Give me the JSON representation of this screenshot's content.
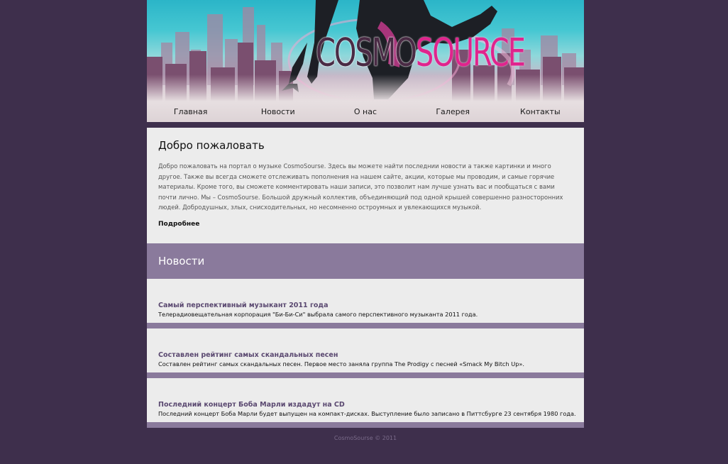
{
  "brand": {
    "logo_part1": "COSMO",
    "logo_part2": "SOURCE"
  },
  "nav": {
    "items": [
      "Главная",
      "Новости",
      "О нас",
      "Галерея",
      "Контакты"
    ]
  },
  "welcome": {
    "title": "Добро пожаловать",
    "text": "Добро пожаловать на портал о музыке CosmoSourse. Здесь вы можете найти последнии новости а также картинки и много другое. Также вы всегда сможете отслеживать пополнения на нашем сайте, акции, которые мы проводим, и самые горячие материалы. Кроме того, вы сможете комментировать наши записи, это позволит нам лучше узнать вас и пообщаться с вами почти лично. Мы – CosmoSourse. Большой дружный коллектив, объединяющий под одной крышей совершенно разносторонних людей. Добродушных, злых, снисходительных, но несомненно остроумных и увлекающихся музыкой.",
    "more_label": "Подробнее"
  },
  "news": {
    "heading": "Новости",
    "items": [
      {
        "title": "Самый перспективный музыкант 2011 года",
        "text": "Телерадиовещательная корпорация \"Би-Би-Си\" выбрала самого перспективного музыканта 2011 года."
      },
      {
        "title": "Составлен рейтинг самых скандальных песен",
        "text": "Составлен рейтинг самых скандальных песен. Первое место заняла группа The Prodigy с песней «Smack My Bitch Up»."
      },
      {
        "title": "Последний концерт Боба Марли издадут на CD",
        "text": "Последний концерт Боба Марли будет выпущен на компакт-дисках. Выступление было записано в Питтсбурге 23 сентября 1980 года."
      }
    ]
  },
  "footer": {
    "text": "CosmoSourse © 2011"
  },
  "colors": {
    "page_bg": "#3e2f4c",
    "accent": "#8a7a9c",
    "logo_pink": "#e0248d"
  }
}
